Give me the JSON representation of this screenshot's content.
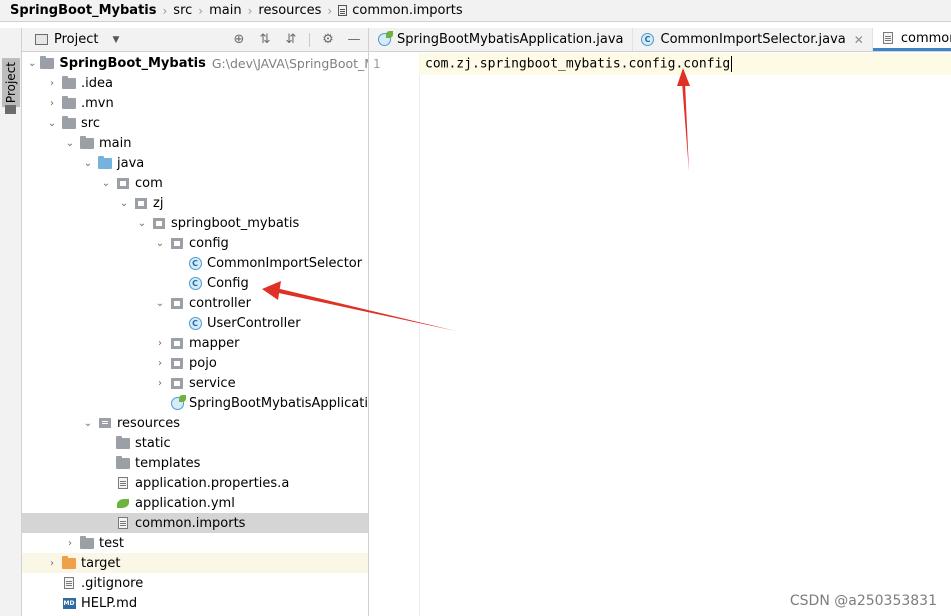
{
  "breadcrumb": {
    "items": [
      "SpringBoot_Mybatis",
      "src",
      "main",
      "resources",
      "common.imports"
    ]
  },
  "tool_window": {
    "vertical_label": "Project"
  },
  "project_panel": {
    "title": "Project",
    "header_icons": [
      "crosshair-icon",
      "expand-all-icon",
      "collapse-all-icon",
      "gear-icon",
      "minimize-icon"
    ]
  },
  "tree": [
    {
      "label": "SpringBoot_Mybatis",
      "hint": "G:\\dev\\JAVA\\SpringBoot_Myb",
      "icon": "module-folder-icon",
      "expanded": true
    },
    {
      "label": ".idea",
      "icon": "folder-icon",
      "expanded": false
    },
    {
      "label": ".mvn",
      "icon": "folder-icon",
      "expanded": false
    },
    {
      "label": "src",
      "icon": "folder-icon",
      "expanded": true
    },
    {
      "label": "main",
      "icon": "folder-icon",
      "expanded": true
    },
    {
      "label": "java",
      "icon": "source-folder-icon",
      "expanded": true
    },
    {
      "label": "com",
      "icon": "package-icon",
      "expanded": true
    },
    {
      "label": "zj",
      "icon": "package-icon",
      "expanded": true
    },
    {
      "label": "springboot_mybatis",
      "icon": "package-icon",
      "expanded": true
    },
    {
      "label": "config",
      "icon": "package-icon",
      "expanded": true
    },
    {
      "label": "CommonImportSelector",
      "icon": "class-icon"
    },
    {
      "label": "Config",
      "icon": "class-icon"
    },
    {
      "label": "controller",
      "icon": "package-icon",
      "expanded": true
    },
    {
      "label": "UserController",
      "icon": "class-icon"
    },
    {
      "label": "mapper",
      "icon": "package-icon",
      "expanded": false
    },
    {
      "label": "pojo",
      "icon": "package-icon",
      "expanded": false
    },
    {
      "label": "service",
      "icon": "package-icon",
      "expanded": false
    },
    {
      "label": "SpringBootMybatisApplication",
      "icon": "spring-boot-class-icon"
    },
    {
      "label": "resources",
      "icon": "resources-folder-icon",
      "expanded": true
    },
    {
      "label": "static",
      "icon": "folder-icon"
    },
    {
      "label": "templates",
      "icon": "folder-icon"
    },
    {
      "label": "application.properties.a",
      "icon": "text-file-icon"
    },
    {
      "label": "application.yml",
      "icon": "spring-config-icon"
    },
    {
      "label": "common.imports",
      "icon": "text-file-icon",
      "selected": true
    },
    {
      "label": "test",
      "icon": "folder-icon",
      "expanded": false
    },
    {
      "label": "target",
      "icon": "excluded-folder-icon",
      "expanded": false
    },
    {
      "label": ".gitignore",
      "icon": "gitignore-file-icon"
    },
    {
      "label": "HELP.md",
      "icon": "markdown-file-icon"
    }
  ],
  "editor": {
    "tabs": [
      {
        "label": "SpringBootMybatisApplication.java",
        "icon": "spring-boot-class-icon",
        "active": false
      },
      {
        "label": "CommonImportSelector.java",
        "icon": "class-icon",
        "active": false
      },
      {
        "label": "common.impor",
        "icon": "text-file-icon",
        "active": true
      }
    ],
    "line_number": "1",
    "code_line": "com.zj.springboot_mybatis.config.config"
  },
  "annotations": {
    "arrow_color": "#e03127"
  },
  "watermark": "CSDN @a250353831"
}
